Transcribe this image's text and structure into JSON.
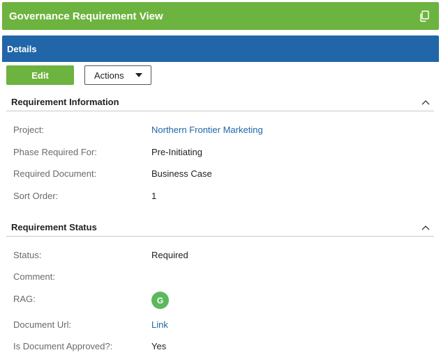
{
  "header": {
    "title": "Governance Requirement View",
    "copy_icon": "copy-icon"
  },
  "details_bar": {
    "label": "Details"
  },
  "toolbar": {
    "edit_label": "Edit",
    "actions_label": "Actions"
  },
  "sections": {
    "requirement_information": {
      "title": "Requirement Information",
      "fields": {
        "project": {
          "label": "Project:",
          "value": "Northern Frontier Marketing"
        },
        "phase": {
          "label": "Phase Required For:",
          "value": "Pre-Initiating"
        },
        "document": {
          "label": "Required Document:",
          "value": "Business Case"
        },
        "sort_order": {
          "label": "Sort Order:",
          "value": "1"
        }
      }
    },
    "requirement_status": {
      "title": "Requirement Status",
      "fields": {
        "status": {
          "label": "Status:",
          "value": "Required"
        },
        "comment": {
          "label": "Comment:",
          "value": ""
        },
        "rag": {
          "label": "RAG:",
          "value": "G",
          "color": "#5cb85c"
        },
        "document_url": {
          "label": "Document Url:",
          "value": "Link"
        },
        "approved": {
          "label": "Is Document Approved?:",
          "value": "Yes"
        }
      }
    }
  },
  "colors": {
    "title_bar": "#6db33f",
    "details_bar": "#2066a8",
    "link": "#2066a8"
  }
}
